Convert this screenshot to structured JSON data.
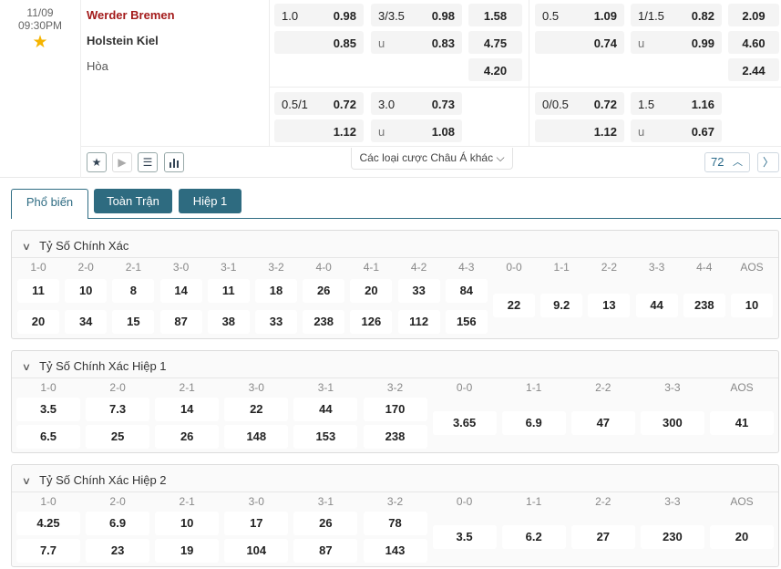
{
  "match": {
    "date": "11/09",
    "time": "09:30PM",
    "home": "Werder Bremen",
    "away": "Holstein Kiel",
    "draw": "Hòa",
    "more_bets": "Các loại cược Châu Á khác",
    "count": "72",
    "left_odds": {
      "hcp1_line": "1.0",
      "hcp1_home": "0.98",
      "hcp1_away": "0.85",
      "ou1_line": "3/3.5",
      "ou1_over": "0.98",
      "ou1_u": "u",
      "ou1_under": "0.83",
      "x12_home": "1.58",
      "x12_away": "4.75",
      "x12_draw": "4.20",
      "hcp2_line": "0.5/1",
      "hcp2_home": "0.72",
      "hcp2_away": "1.12",
      "ou2_line": "3.0",
      "ou2_over": "0.73",
      "ou2_u": "u",
      "ou2_under": "1.08"
    },
    "right_odds": {
      "hcp1_line": "0.5",
      "hcp1_home": "1.09",
      "hcp1_away": "0.74",
      "ou1_line": "1/1.5",
      "ou1_over": "0.82",
      "ou1_u": "u",
      "ou1_under": "0.99",
      "x12_home": "2.09",
      "x12_away": "4.60",
      "x12_draw": "2.44",
      "hcp2_line": "0/0.5",
      "hcp2_home": "0.72",
      "hcp2_away": "1.12",
      "ou2_line": "1.5",
      "ou2_over": "1.16",
      "ou2_u": "u",
      "ou2_under": "0.67"
    }
  },
  "tabs": [
    "Phổ biến",
    "Toàn Trận",
    "Hiệp 1"
  ],
  "sections": [
    {
      "title": "Tỷ Số Chính Xác",
      "home_scores": [
        "1-0",
        "2-0",
        "2-1",
        "3-0",
        "3-1",
        "3-2",
        "4-0",
        "4-1",
        "4-2",
        "4-3"
      ],
      "home_odds": [
        "11",
        "10",
        "8",
        "14",
        "11",
        "18",
        "26",
        "20",
        "33",
        "84"
      ],
      "away_odds": [
        "20",
        "34",
        "15",
        "87",
        "38",
        "33",
        "238",
        "126",
        "112",
        "156"
      ],
      "draw_scores": [
        "0-0",
        "1-1",
        "2-2",
        "3-3",
        "4-4",
        "AOS"
      ],
      "draw_odds": [
        "22",
        "9.2",
        "13",
        "44",
        "238",
        "10"
      ]
    },
    {
      "title": "Tỷ Số Chính Xác Hiệp 1",
      "home_scores": [
        "1-0",
        "2-0",
        "2-1",
        "3-0",
        "3-1",
        "3-2"
      ],
      "home_odds": [
        "3.5",
        "7.3",
        "14",
        "22",
        "44",
        "170"
      ],
      "away_odds": [
        "6.5",
        "25",
        "26",
        "148",
        "153",
        "238"
      ],
      "draw_scores": [
        "0-0",
        "1-1",
        "2-2",
        "3-3",
        "AOS"
      ],
      "draw_odds": [
        "3.65",
        "6.9",
        "47",
        "300",
        "41"
      ]
    },
    {
      "title": "Tỷ Số Chính Xác Hiệp 2",
      "home_scores": [
        "1-0",
        "2-0",
        "2-1",
        "3-0",
        "3-1",
        "3-2"
      ],
      "home_odds": [
        "4.25",
        "6.9",
        "10",
        "17",
        "26",
        "78"
      ],
      "away_odds": [
        "7.7",
        "23",
        "19",
        "104",
        "87",
        "143"
      ],
      "draw_scores": [
        "0-0",
        "1-1",
        "2-2",
        "3-3",
        "AOS"
      ],
      "draw_odds": [
        "3.5",
        "6.2",
        "27",
        "230",
        "20"
      ]
    }
  ]
}
